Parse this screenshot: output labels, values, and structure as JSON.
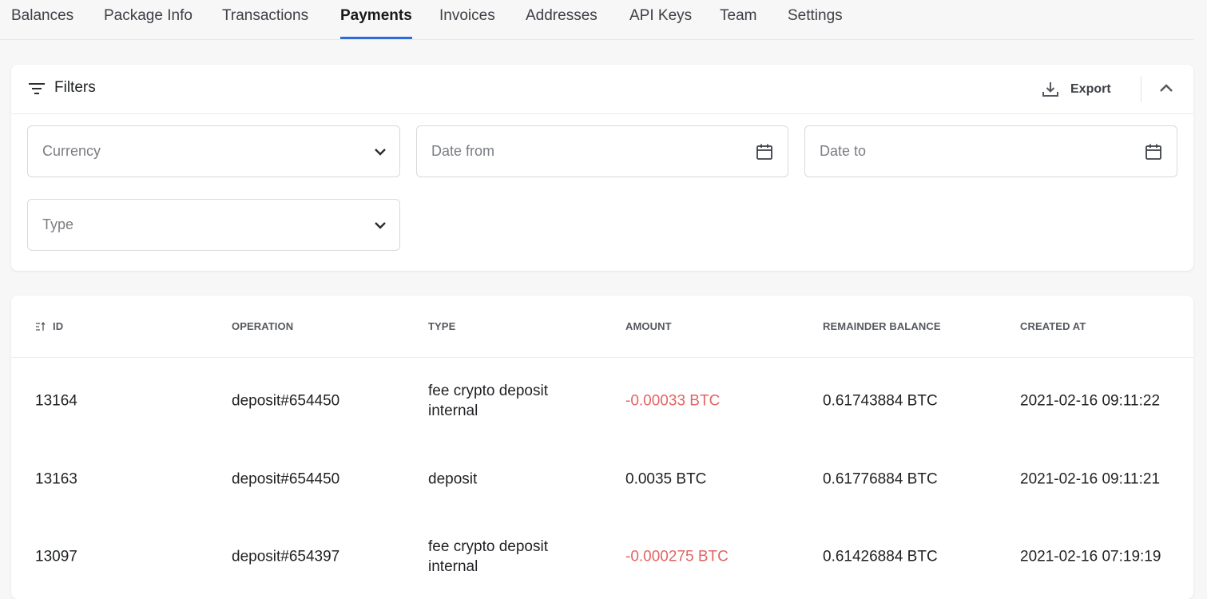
{
  "tabs": [
    {
      "label": "Balances"
    },
    {
      "label": "Package Info"
    },
    {
      "label": "Transactions"
    },
    {
      "label": "Payments"
    },
    {
      "label": "Invoices"
    },
    {
      "label": "Addresses"
    },
    {
      "label": "API Keys"
    },
    {
      "label": "Team"
    },
    {
      "label": "Settings"
    }
  ],
  "active_tab": "Payments",
  "filters": {
    "title": "Filters",
    "export_label": "Export",
    "currency_placeholder": "Currency",
    "date_from_placeholder": "Date from",
    "date_to_placeholder": "Date to",
    "type_placeholder": "Type"
  },
  "table": {
    "headers": {
      "id": "ID",
      "operation": "OPERATION",
      "type": "TYPE",
      "amount": "AMOUNT",
      "remainder_balance": "REMAINDER BALANCE",
      "created_at": "CREATED AT"
    },
    "rows": [
      {
        "id": "13164",
        "operation": "deposit#654450",
        "type": "fee crypto deposit internal",
        "amount": "-0.00033 BTC",
        "amount_negative": true,
        "remainder_balance": "0.61743884 BTC",
        "created_at": "2021-02-16 09:11:22"
      },
      {
        "id": "13163",
        "operation": "deposit#654450",
        "type": "deposit",
        "amount": "0.0035 BTC",
        "amount_negative": false,
        "remainder_balance": "0.61776884 BTC",
        "created_at": "2021-02-16 09:11:21"
      },
      {
        "id": "13097",
        "operation": "deposit#654397",
        "type": "fee crypto deposit internal",
        "amount": "-0.000275 BTC",
        "amount_negative": true,
        "remainder_balance": "0.61426884 BTC",
        "created_at": "2021-02-16 07:19:19"
      }
    ]
  },
  "colors": {
    "accent": "#2f6bdb",
    "negative": "#e36464"
  },
  "icons": {
    "filters": "filter-lines-icon",
    "export": "download-icon",
    "collapse": "chevron-up-icon",
    "dropdown": "chevron-down-icon",
    "date": "calendar-icon",
    "sort": "sort-icon"
  }
}
